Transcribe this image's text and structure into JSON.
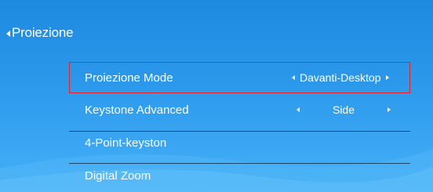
{
  "header": {
    "title": "Proiezione"
  },
  "menu": {
    "items": [
      {
        "label": "Proiezione Mode",
        "value": "Davanti-Desktop"
      },
      {
        "label": "Keystone Advanced",
        "value": "Side"
      },
      {
        "label": "4-Point-keyston"
      },
      {
        "label": "Digital Zoom"
      }
    ]
  },
  "colors": {
    "background_top": "#1d8ae0",
    "background_bottom": "#47b0f6",
    "selection_border": "#e8202a",
    "divider": "#0c2640"
  }
}
